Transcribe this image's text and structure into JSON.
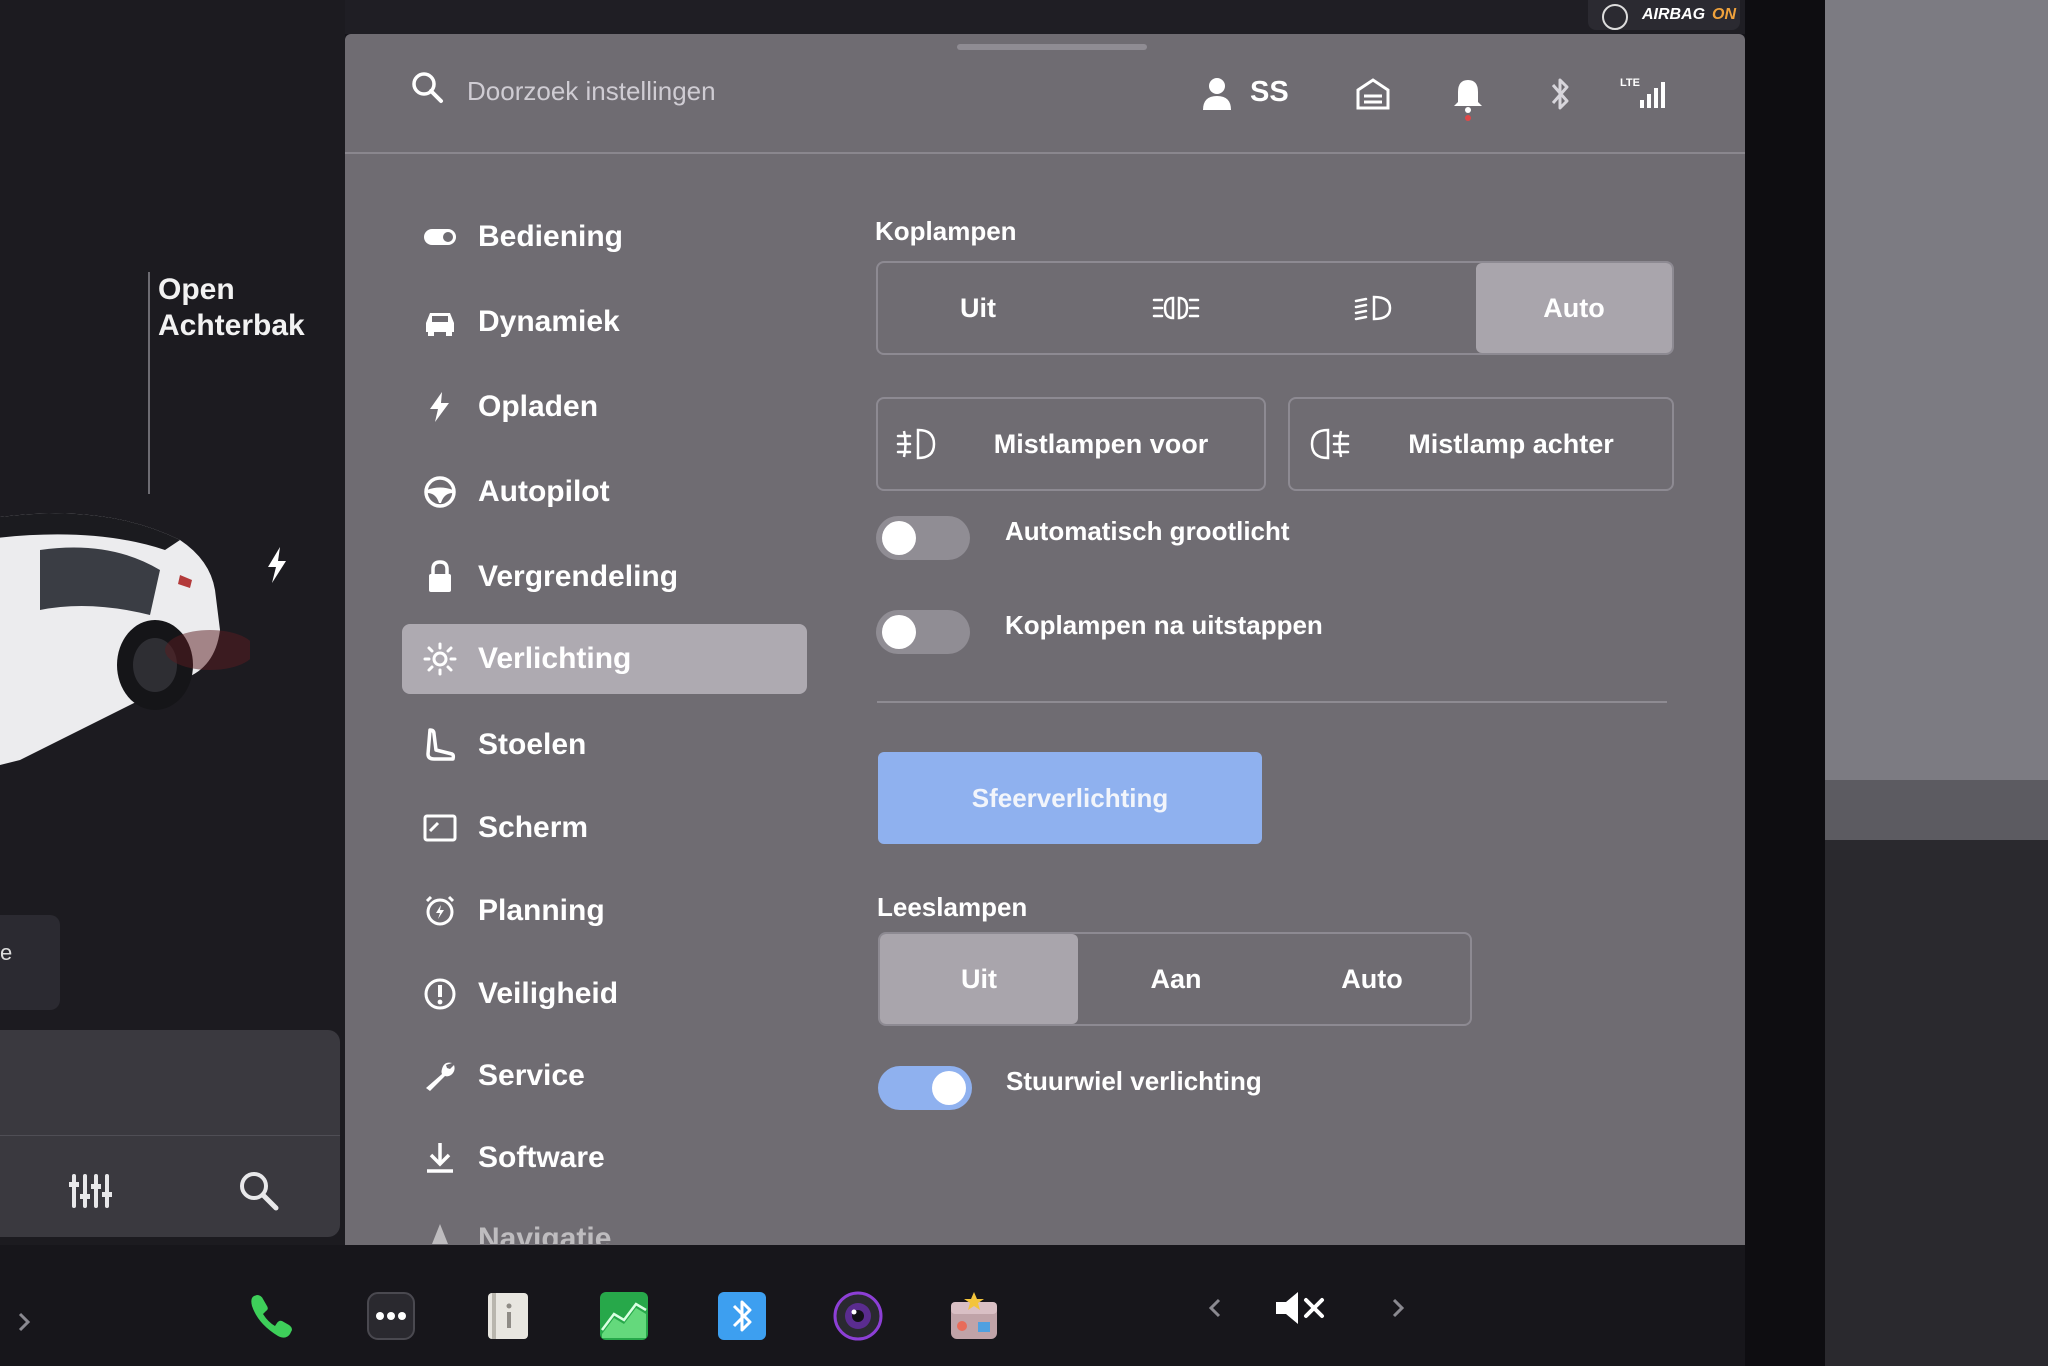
{
  "status": {
    "airbag": {
      "label": "AIRBAG",
      "state": "ON"
    }
  },
  "vehicle": {
    "trunk_label_line1": "Open",
    "trunk_label_line2": "Achterbak",
    "left_tab_stub": "e"
  },
  "header": {
    "search_placeholder": "Doorzoek instellingen",
    "profile_label": "SS",
    "icons": [
      "search-icon",
      "profile-icon",
      "home-icon",
      "bell-icon",
      "bluetooth-icon",
      "lte-signal-icon"
    ],
    "network_label": "LTE"
  },
  "sidebar": {
    "items": [
      {
        "label": "Bediening",
        "icon": "toggle-icon",
        "active": false
      },
      {
        "label": "Dynamiek",
        "icon": "car-icon",
        "active": false
      },
      {
        "label": "Opladen",
        "icon": "lightning-icon",
        "active": false
      },
      {
        "label": "Autopilot",
        "icon": "steering-wheel-icon",
        "active": false
      },
      {
        "label": "Vergrendeling",
        "icon": "lock-icon",
        "active": false
      },
      {
        "label": "Verlichting",
        "icon": "sun-icon",
        "active": true
      },
      {
        "label": "Stoelen",
        "icon": "seat-icon",
        "active": false
      },
      {
        "label": "Scherm",
        "icon": "display-icon",
        "active": false
      },
      {
        "label": "Planning",
        "icon": "alarm-clock-icon",
        "active": false
      },
      {
        "label": "Veiligheid",
        "icon": "alert-circle-icon",
        "active": false
      },
      {
        "label": "Service",
        "icon": "wrench-icon",
        "active": false
      },
      {
        "label": "Software",
        "icon": "download-icon",
        "active": false
      },
      {
        "label": "Navigatie",
        "icon": "navigation-arrow-icon",
        "active": false
      }
    ]
  },
  "lighting": {
    "headlights": {
      "title": "Koplampen",
      "options": [
        "Uit",
        "parking-lights-icon",
        "low-beam-icon",
        "Auto"
      ],
      "selected": "Auto"
    },
    "fog_front_label": "Mistlampen voor",
    "fog_rear_label": "Mistlamp achter",
    "auto_high_beam": {
      "label": "Automatisch grootlicht",
      "on": false
    },
    "headlights_after_exit": {
      "label": "Koplampen na uitstappen",
      "on": false
    },
    "ambient_button_label": "Sfeerverlichting",
    "reading_lights": {
      "title": "Leeslampen",
      "options": [
        "Uit",
        "Aan",
        "Auto"
      ],
      "selected": "Uit"
    },
    "steering_wheel_light": {
      "label": "Stuurwiel verlichting",
      "on": true
    }
  },
  "dock": {
    "icons": [
      "phone-icon",
      "more-apps-icon",
      "manual-icon",
      "energy-chart-icon",
      "bluetooth-app-icon",
      "camera-icon",
      "toybox-icon"
    ],
    "volume_icon": "mute-icon"
  },
  "colors": {
    "panel_bg": "#6f6c72",
    "accent_blue": "#8fb1ef",
    "selected_segment": "#a9a5ac",
    "active_menu": "#aeaab1"
  }
}
